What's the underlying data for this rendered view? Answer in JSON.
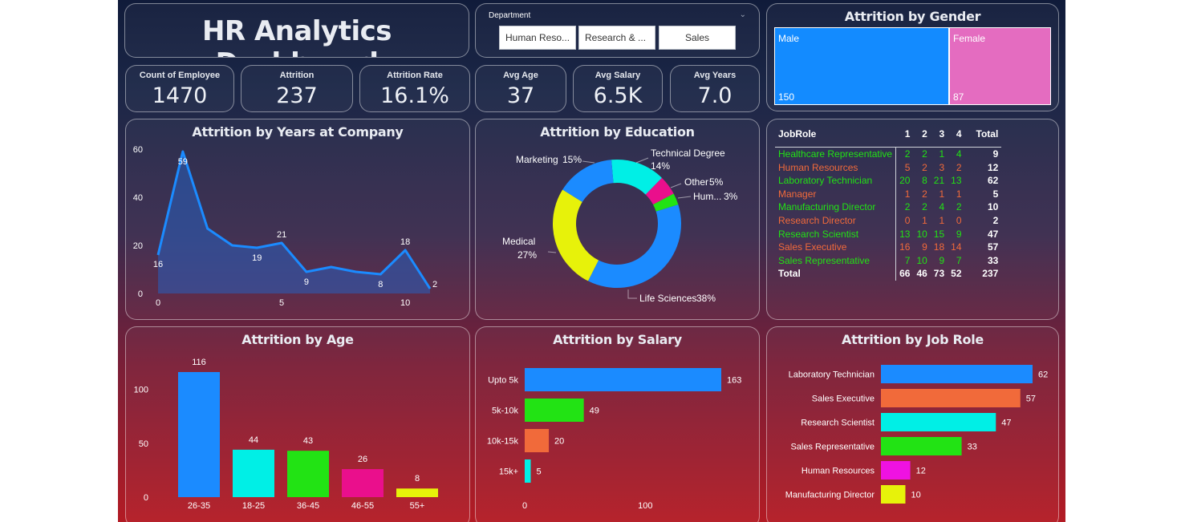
{
  "colors": {
    "green": "#22e314",
    "orange": "#f16a3a",
    "blue": "#1b8bff",
    "cyan": "#00efe6",
    "male": "#138bff",
    "female": "#e46cc0"
  },
  "header": {
    "title": "HR Analytics Dashboard"
  },
  "slicer": {
    "label": "Department",
    "options": [
      "Human Reso...",
      "Research & ...",
      "Sales"
    ]
  },
  "kpis": [
    {
      "label": "Count of Employee",
      "value": "1470"
    },
    {
      "label": "Attrition",
      "value": "237"
    },
    {
      "label": "Attrition Rate",
      "value": "16.1%"
    },
    {
      "label": "Avg Age",
      "value": "37"
    },
    {
      "label": "Avg Salary",
      "value": "6.5K"
    },
    {
      "label": "Avg Years",
      "value": "7.0"
    }
  ],
  "gender": {
    "title": "Attrition by Gender",
    "items": [
      {
        "label": "Male",
        "value": "150"
      },
      {
        "label": "Female",
        "value": "87"
      }
    ]
  },
  "years_chart": {
    "title": "Attrition by Years at Company"
  },
  "education_chart": {
    "title": "Attrition by Education"
  },
  "jobrole_table": {
    "headers": [
      "JobRole",
      "1",
      "2",
      "3",
      "4",
      "Total"
    ],
    "rows": [
      {
        "role": "Healthcare Representative",
        "v1": "2",
        "v2": "2",
        "v3": "1",
        "v4": "4",
        "total": "9"
      },
      {
        "role": "Human Resources",
        "v1": "5",
        "v2": "2",
        "v3": "3",
        "v4": "2",
        "total": "12"
      },
      {
        "role": "Laboratory Technician",
        "v1": "20",
        "v2": "8",
        "v3": "21",
        "v4": "13",
        "total": "62"
      },
      {
        "role": "Manager",
        "v1": "1",
        "v2": "2",
        "v3": "1",
        "v4": "1",
        "total": "5"
      },
      {
        "role": "Manufacturing Director",
        "v1": "2",
        "v2": "2",
        "v3": "4",
        "v4": "2",
        "total": "10"
      },
      {
        "role": "Research Director",
        "v1": "0",
        "v2": "1",
        "v3": "1",
        "v4": "0",
        "total": "2"
      },
      {
        "role": "Research Scientist",
        "v1": "13",
        "v2": "10",
        "v3": "15",
        "v4": "9",
        "total": "47"
      },
      {
        "role": "Sales Executive",
        "v1": "16",
        "v2": "9",
        "v3": "18",
        "v4": "14",
        "total": "57"
      },
      {
        "role": "Sales Representative",
        "v1": "7",
        "v2": "10",
        "v3": "9",
        "v4": "7",
        "total": "33"
      }
    ],
    "total": {
      "role": "Total",
      "v1": "66",
      "v2": "46",
      "v3": "73",
      "v4": "52",
      "total": "237"
    }
  },
  "age_chart": {
    "title": "Attrition by Age"
  },
  "salary_chart": {
    "title": "Attrition by Salary"
  },
  "role_chart": {
    "title": "Attrition by Job Role"
  },
  "chart_data": [
    {
      "id": "years",
      "type": "area",
      "title": "Attrition by Years at Company",
      "x": [
        0,
        1,
        2,
        3,
        4,
        5,
        6,
        7,
        8,
        9,
        10,
        11
      ],
      "values": [
        16,
        59,
        27,
        20,
        19,
        21,
        9,
        11,
        9,
        8,
        18,
        2
      ],
      "data_labels": {
        "0": "16",
        "1": "59",
        "4": "19",
        "5": "21",
        "6": "9",
        "9": "8",
        "10": "18",
        "11": "2"
      },
      "x_ticks": [
        "0",
        "5",
        "10"
      ],
      "y_ticks": [
        "0",
        "20",
        "40",
        "60"
      ],
      "ylim": [
        0,
        60
      ],
      "color": "#1b8bff"
    },
    {
      "id": "education",
      "type": "pie",
      "donut": true,
      "title": "Attrition by Education",
      "slices": [
        {
          "label": "Technical Degree",
          "pct": "14%",
          "value": 14,
          "color": "#00efe6"
        },
        {
          "label": "Other",
          "pct": "5%",
          "value": 5,
          "color": "#ea0f8c"
        },
        {
          "label": "Hum...",
          "pct": "3%",
          "value": 3,
          "color": "#22e314"
        },
        {
          "label": "Life Sciences",
          "pct": "38%",
          "value": 38,
          "color": "#1b8bff"
        },
        {
          "label": "Medical",
          "pct": "27%",
          "value": 27,
          "color": "#e7f20a"
        },
        {
          "label": "Marketing",
          "pct": "15%",
          "value": 15,
          "color": "#1b8bff"
        }
      ]
    },
    {
      "id": "age",
      "type": "bar",
      "title": "Attrition by Age",
      "categories": [
        "26-35",
        "18-25",
        "36-45",
        "46-55",
        "55+"
      ],
      "values": [
        116,
        44,
        43,
        26,
        8
      ],
      "colors": [
        "#1b8bff",
        "#00efe6",
        "#22e314",
        "#ea0f8c",
        "#e7f20a"
      ],
      "y_ticks": [
        "0",
        "50",
        "100"
      ],
      "ylim": [
        0,
        116
      ]
    },
    {
      "id": "salary",
      "type": "bar",
      "orientation": "horizontal",
      "title": "Attrition by Salary",
      "categories": [
        "Upto 5k",
        "5k-10k",
        "10k-15k",
        "15k+"
      ],
      "values": [
        163,
        49,
        20,
        5
      ],
      "colors": [
        "#1b8bff",
        "#22e314",
        "#f16a3a",
        "#00efe6"
      ],
      "x_ticks": [
        "0",
        "100"
      ],
      "xlim": [
        0,
        163
      ]
    },
    {
      "id": "jobrole",
      "type": "bar",
      "orientation": "horizontal",
      "title": "Attrition by Job Role",
      "categories": [
        "Laboratory Technician",
        "Sales Executive",
        "Research Scientist",
        "Sales Representative",
        "Human Resources",
        "Manufacturing Director"
      ],
      "values": [
        62,
        57,
        47,
        33,
        12,
        10
      ],
      "colors": [
        "#1b8bff",
        "#f16a3a",
        "#00efe6",
        "#22e314",
        "#ef12e2",
        "#e7f20a"
      ],
      "xlim": [
        0,
        62
      ]
    }
  ]
}
